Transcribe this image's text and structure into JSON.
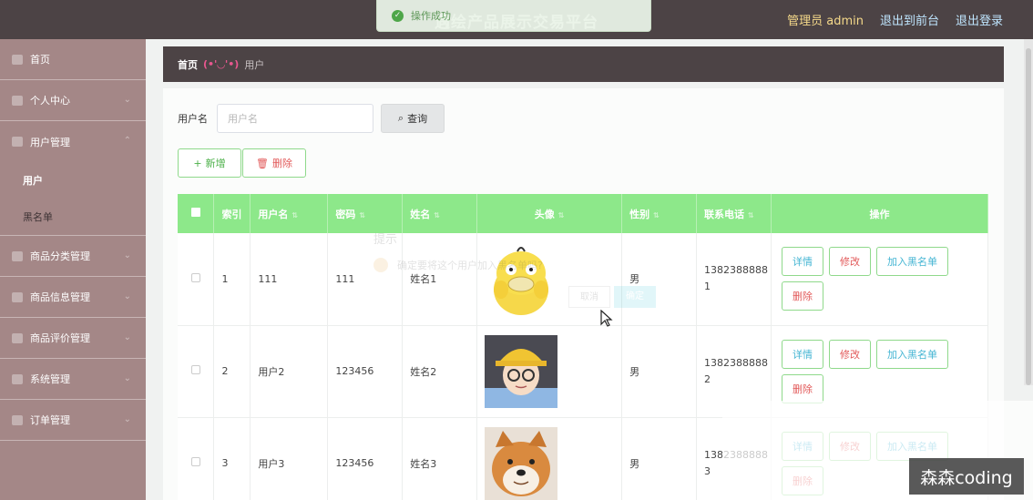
{
  "app": {
    "title": "遇绘产品展示交易平台",
    "admin_label": "管理员 admin",
    "back_to_front": "退出到前台",
    "logout": "退出登录"
  },
  "toast": {
    "message": "操作成功"
  },
  "sidebar": {
    "items": [
      {
        "label": "首页"
      },
      {
        "label": "个人中心"
      },
      {
        "label": "用户管理"
      },
      {
        "label": "商品分类管理"
      },
      {
        "label": "商品信息管理"
      },
      {
        "label": "商品评价管理"
      },
      {
        "label": "系统管理"
      },
      {
        "label": "订单管理"
      }
    ],
    "sub_items": [
      {
        "label": "用户",
        "active": true
      },
      {
        "label": "黑名单",
        "active": false
      }
    ]
  },
  "breadcrumb": {
    "home": "首页",
    "face": "(•'◡'•)",
    "current": "用户"
  },
  "search": {
    "label": "用户名",
    "placeholder": "用户名",
    "value": "",
    "button": "查询"
  },
  "actions": {
    "add": "新增",
    "delete": "删除"
  },
  "table": {
    "headers": {
      "index": "索引",
      "username": "用户名",
      "password": "密码",
      "name": "姓名",
      "avatar": "头像",
      "gender": "性别",
      "phone": "联系电话",
      "ops": "操作"
    },
    "ops": {
      "detail": "详情",
      "edit": "修改",
      "blacklist": "加入黑名单",
      "delete": "删除"
    },
    "rows": [
      {
        "index": "1",
        "username": "111",
        "password": "111",
        "name": "姓名1",
        "gender": "男",
        "phone": "13823888881"
      },
      {
        "index": "2",
        "username": "用户2",
        "password": "123456",
        "name": "姓名2",
        "gender": "男",
        "phone": "13823888882"
      },
      {
        "index": "3",
        "username": "用户3",
        "password": "123456",
        "name": "姓名3",
        "gender": "男",
        "phone": "13823888883"
      }
    ]
  },
  "dialog": {
    "title": "提示",
    "message": "确定要将这个用户加入黑名单吗?",
    "cancel": "取消",
    "confirm": "确定"
  },
  "watermark": "森森coding",
  "colors": {
    "topbar": "#4c4345",
    "sidebar": "#a48787",
    "table_header": "#8de88a",
    "accent_green": "#4cb049",
    "danger": "#e25a5a",
    "info": "#44b5d3"
  }
}
